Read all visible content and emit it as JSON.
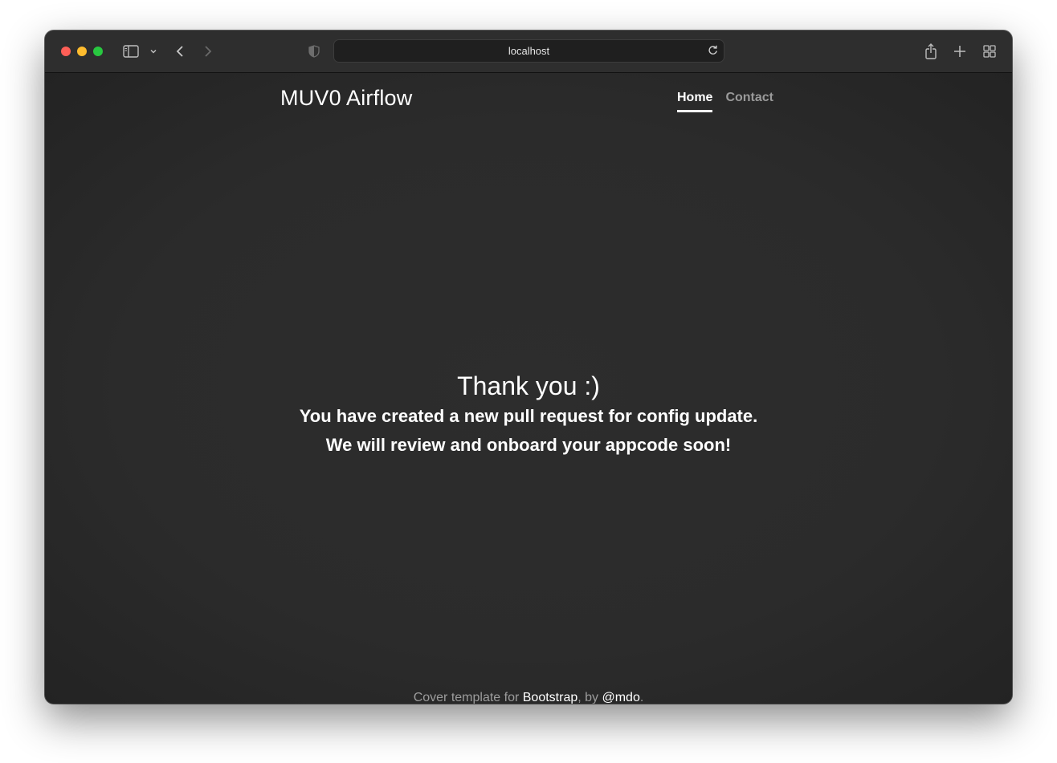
{
  "browser": {
    "url": "localhost"
  },
  "header": {
    "brand": "MUV0 Airflow",
    "nav": [
      {
        "label": "Home",
        "active": true
      },
      {
        "label": "Contact",
        "active": false
      }
    ]
  },
  "main": {
    "heading": "Thank you :)",
    "line1": "You have created a new pull request for config update.",
    "line2": "We will review and onboard your appcode soon!"
  },
  "footer": {
    "prefix": "Cover template for ",
    "link1": "Bootstrap",
    "middle": ", by ",
    "link2": "@mdo",
    "suffix": "."
  },
  "colors": {
    "background": "#2b2b2b",
    "text": "#ffffff",
    "muted": "#9c9c9c"
  }
}
